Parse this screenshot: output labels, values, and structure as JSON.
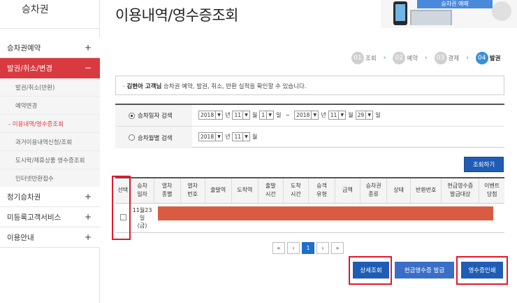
{
  "sidebar": {
    "title": "승차권",
    "menus": [
      {
        "label": "승차권예약",
        "toggle": "+"
      },
      {
        "label": "발권/취소/변경",
        "toggle": "−"
      },
      {
        "label": "정기승차권",
        "toggle": "+"
      },
      {
        "label": "미등록고객서비스",
        "toggle": "+"
      },
      {
        "label": "이용안내",
        "toggle": "+"
      }
    ],
    "subs": [
      "발권/취소(반환)",
      "예약변경",
      "- 이용내역/영수증조회",
      "과거이용내역신청/조회",
      "도시락/제휴상품 영수증조회",
      "인터넷반환접수"
    ]
  },
  "header": {
    "title": "이용내역/영수증조회",
    "banner_label": "승차권 예매"
  },
  "steps": [
    {
      "num": "01",
      "label": "조회"
    },
    {
      "num": "02",
      "label": "예약"
    },
    {
      "num": "03",
      "label": "결제"
    },
    {
      "num": "04",
      "label": "발권"
    }
  ],
  "step_arrow": "›",
  "info": {
    "bullet": "·",
    "name": "김현아 고객님",
    "text": "승차권 예약, 발권, 취소, 반환 실적을 확인할 수 있습니다."
  },
  "search": {
    "by_date": {
      "label": "승차일자 검색",
      "from_year": "2018",
      "from_month": "11",
      "from_day": "1",
      "to_year": "2018",
      "to_month": "11",
      "to_day": "29",
      "unit_year": "년",
      "unit_month": "월",
      "unit_day": "일",
      "tilde": "~"
    },
    "by_month": {
      "label": "승차월별 검색",
      "year": "2018",
      "month": "11"
    },
    "button": "조회하기"
  },
  "table": {
    "headers": [
      "선택",
      "승차\n일자",
      "열차\n종별",
      "열차\n번호",
      "출발역",
      "도착역",
      "출발\n시간",
      "도착\n시간",
      "승객\n유형",
      "금액",
      "승차권\n종류",
      "상태",
      "반환번호",
      "현금영수증\n발급대상",
      "이벤트\n당첨"
    ],
    "row": {
      "date_line1": "11월23일",
      "date_line2": "(금)"
    }
  },
  "pager": {
    "first": "«",
    "prev": "‹",
    "current": "1",
    "next": "›",
    "last": "»"
  },
  "buttons": {
    "detail": "상세조회",
    "cash_receipt": "현금영수증 발급",
    "receipt_print": "영수증인쇄"
  },
  "colors": {
    "accent_red": "#d93a3f",
    "primary_blue": "#1f5db5",
    "highlight": "#e3182c"
  }
}
